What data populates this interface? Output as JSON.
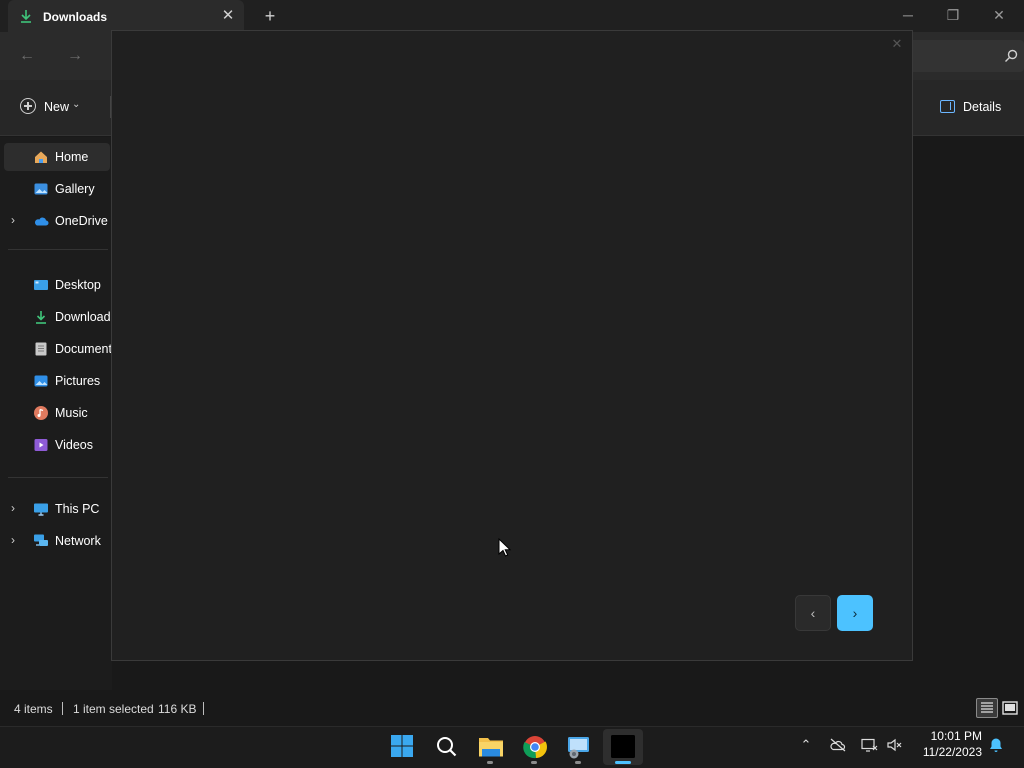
{
  "window": {
    "tab_title": "Downloads",
    "tab_close": "✕",
    "new_tab": "+",
    "minimize": "─",
    "restore": "❐",
    "close": "✕"
  },
  "nav": {
    "back": "←",
    "forward": "→"
  },
  "command_bar": {
    "new_label": "New",
    "new_chevron": "⌄",
    "details_label": "Details"
  },
  "sidebar": {
    "items": [
      {
        "label": "Home",
        "icon": "home-icon"
      },
      {
        "label": "Gallery",
        "icon": "gallery-icon"
      },
      {
        "label": "OneDrive",
        "icon": "onedrive-icon",
        "expander": "›"
      },
      {
        "label": "Desktop",
        "icon": "desktop-icon"
      },
      {
        "label": "Downloads",
        "icon": "downloads-icon"
      },
      {
        "label": "Documents",
        "icon": "documents-icon"
      },
      {
        "label": "Pictures",
        "icon": "pictures-icon"
      },
      {
        "label": "Music",
        "icon": "music-icon"
      },
      {
        "label": "Videos",
        "icon": "videos-icon"
      },
      {
        "label": "This PC",
        "icon": "this-pc-icon",
        "expander": "›"
      },
      {
        "label": "Network",
        "icon": "network-icon",
        "expander": "›"
      }
    ]
  },
  "dialog": {
    "close": "✕",
    "prev": "‹",
    "next": "›",
    "accent": "#4cc2ff"
  },
  "status": {
    "item_count": "4 items",
    "selection": "1 item selected",
    "size": "116 KB"
  },
  "taskbar": {
    "apps": [
      "start-icon",
      "search-icon",
      "file-explorer-icon",
      "chrome-icon",
      "remote-desktop-icon",
      "terminal-icon"
    ],
    "tray": {
      "chevron": "⌃"
    },
    "time": "10:01 PM",
    "date": "11/22/2023"
  }
}
